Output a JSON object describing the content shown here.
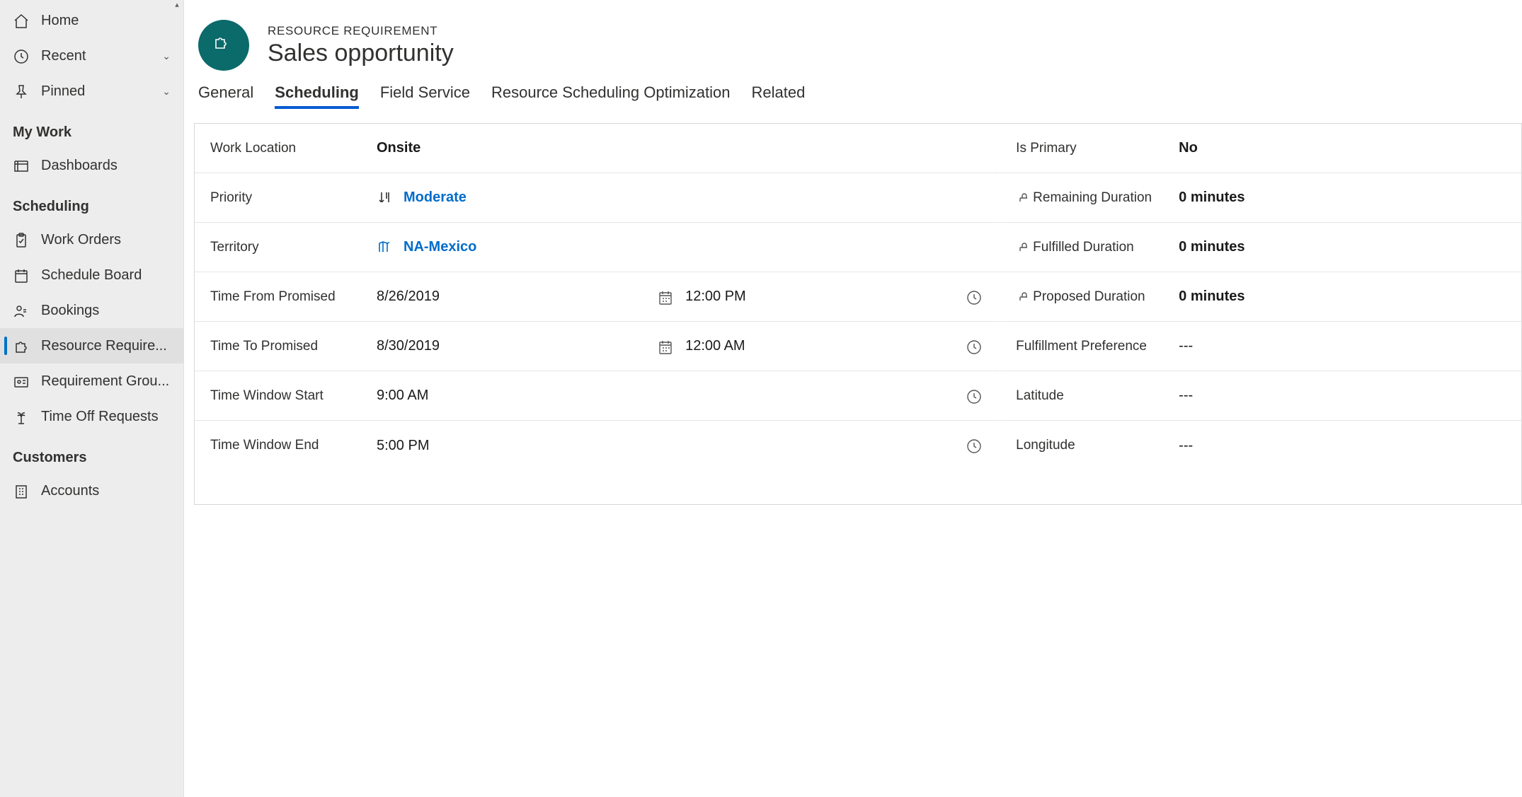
{
  "sidebar": {
    "top": [
      {
        "label": "Home",
        "icon": "home",
        "chevron": false
      },
      {
        "label": "Recent",
        "icon": "clock",
        "chevron": true
      },
      {
        "label": "Pinned",
        "icon": "pin",
        "chevron": true
      }
    ],
    "sections": [
      {
        "title": "My Work",
        "items": [
          {
            "label": "Dashboards",
            "icon": "dashboard",
            "active": false
          }
        ]
      },
      {
        "title": "Scheduling",
        "items": [
          {
            "label": "Work Orders",
            "icon": "clipboard",
            "active": false
          },
          {
            "label": "Schedule Board",
            "icon": "calendar",
            "active": false
          },
          {
            "label": "Bookings",
            "icon": "person",
            "active": false
          },
          {
            "label": "Resource Require...",
            "icon": "puzzle",
            "active": true
          },
          {
            "label": "Requirement Grou...",
            "icon": "idcard",
            "active": false
          },
          {
            "label": "Time Off Requests",
            "icon": "palm",
            "active": false
          }
        ]
      },
      {
        "title": "Customers",
        "items": [
          {
            "label": "Accounts",
            "icon": "building",
            "active": false
          }
        ]
      }
    ]
  },
  "header": {
    "eyebrow": "RESOURCE REQUIREMENT",
    "title": "Sales opportunity"
  },
  "tabs": [
    {
      "label": "General",
      "active": false
    },
    {
      "label": "Scheduling",
      "active": true
    },
    {
      "label": "Field Service",
      "active": false
    },
    {
      "label": "Resource Scheduling Optimization",
      "active": false
    },
    {
      "label": "Related",
      "active": false
    }
  ],
  "form": {
    "left": {
      "work_location_label": "Work Location",
      "work_location_value": "Onsite",
      "priority_label": "Priority",
      "priority_value": "Moderate",
      "territory_label": "Territory",
      "territory_value": "NA-Mexico",
      "time_from_label": "Time From Promised",
      "time_from_date": "8/26/2019",
      "time_from_time": "12:00 PM",
      "time_to_label": "Time To Promised",
      "time_to_date": "8/30/2019",
      "time_to_time": "12:00 AM",
      "window_start_label": "Time Window Start",
      "window_start_value": "9:00 AM",
      "window_end_label": "Time Window End",
      "window_end_value": "5:00 PM"
    },
    "right": {
      "is_primary_label": "Is Primary",
      "is_primary_value": "No",
      "remaining_label": "Remaining Duration",
      "remaining_value": "0 minutes",
      "fulfilled_label": "Fulfilled Duration",
      "fulfilled_value": "0 minutes",
      "proposed_label": "Proposed Duration",
      "proposed_value": "0 minutes",
      "fulfillment_pref_label": "Fulfillment Preference",
      "fulfillment_pref_value": "---",
      "latitude_label": "Latitude",
      "latitude_value": "---",
      "longitude_label": "Longitude",
      "longitude_value": "---"
    }
  }
}
